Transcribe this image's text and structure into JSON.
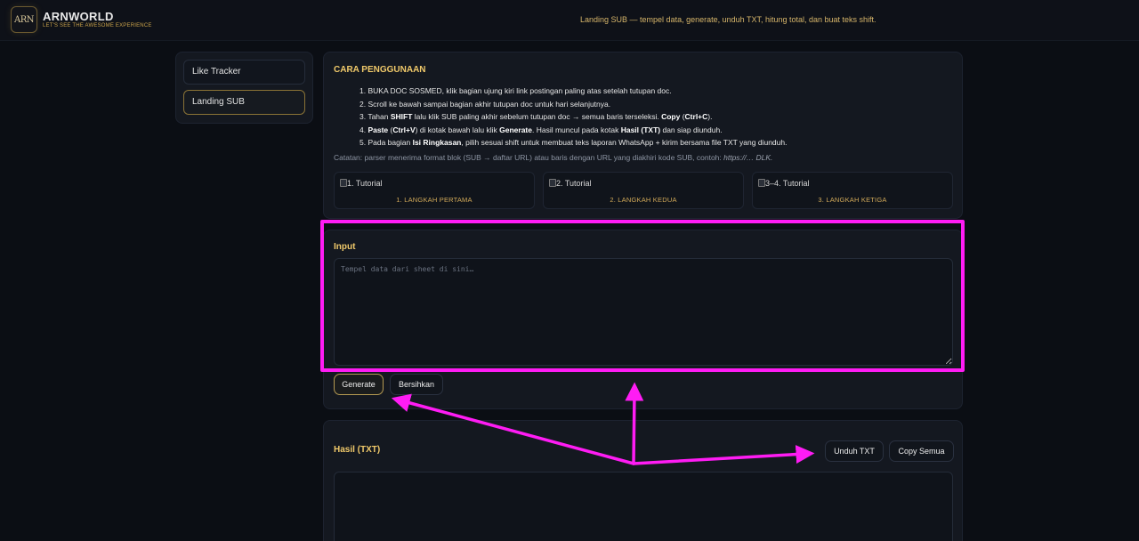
{
  "header": {
    "logo_text": "ARN",
    "brand_name": "ARNWORLD",
    "brand_tagline": "LET'S SEE THE AWESOME EXPERIENCE",
    "description": "Landing SUB — tempel data, generate, unduh TXT, hitung total, dan buat teks shift."
  },
  "sidebar": {
    "items": [
      {
        "label": "Like Tracker",
        "active": false
      },
      {
        "label": "Landing SUB",
        "active": true
      }
    ]
  },
  "guide": {
    "title": "CARA PENGGUNAAN",
    "steps": [
      {
        "num": "1.",
        "pre": "BUKA DOC SOSMED, klik bagian ujung kiri link postingan paling atas setelah tutupan doc.",
        "b1": "",
        "mid1": "",
        "b2": "",
        "mid2": "",
        "b3": "",
        "post": ""
      },
      {
        "num": "2.",
        "pre": "Scroll ke bawah sampai bagian akhir tutupan doc untuk hari selanjutnya.",
        "b1": "",
        "mid1": "",
        "b2": "",
        "mid2": "",
        "b3": "",
        "post": ""
      },
      {
        "num": "3.",
        "pre": "Tahan ",
        "b1": "SHIFT",
        "mid1": " lalu klik SUB paling akhir sebelum tutupan doc → semua baris terseleksi. ",
        "b2": "Copy",
        "mid2": " (",
        "b3": "Ctrl+C",
        "post": ")."
      },
      {
        "num": "4.",
        "pre": "",
        "b1": "Paste",
        "mid1": " (",
        "b2": "Ctrl+V",
        "mid2": ") di kotak bawah lalu klik ",
        "b3": "Generate",
        "post": ". Hasil muncul pada kotak "
      },
      {
        "num": "5.",
        "pre": "Pada bagian ",
        "b1": "Isi Ringkasan",
        "mid1": ", pilih sesuai shift untuk membuat teks laporan WhatsApp + kirim bersama file TXT yang diunduh.",
        "b2": "",
        "mid2": "",
        "b3": "",
        "post": ""
      }
    ],
    "step4_tail_bold": "Hasil (TXT)",
    "step4_tail": " dan siap diunduh.",
    "note_prefix": "Catatan: parser menerima format blok (SUB → daftar URL) atau baris dengan URL yang diakhiri kode SUB, contoh: ",
    "note_example": "https://…  DLK.",
    "tutorials": [
      {
        "alt": "1. Tutorial",
        "caption": "1. LANGKAH PERTAMA"
      },
      {
        "alt": "2. Tutorial",
        "caption": "2. LANGKAH KEDUA"
      },
      {
        "alt": "3–4. Tutorial",
        "caption": "3. LANGKAH KETIGA"
      }
    ]
  },
  "input": {
    "title": "Input",
    "placeholder": "Tempel data dari sheet di sini…",
    "value": "",
    "generate_label": "Generate",
    "clear_label": "Bersihkan"
  },
  "result": {
    "title": "Hasil (TXT)",
    "download_label": "Unduh TXT",
    "copy_label": "Copy Semua"
  },
  "annotation": {
    "color": "#ff1cf4"
  }
}
